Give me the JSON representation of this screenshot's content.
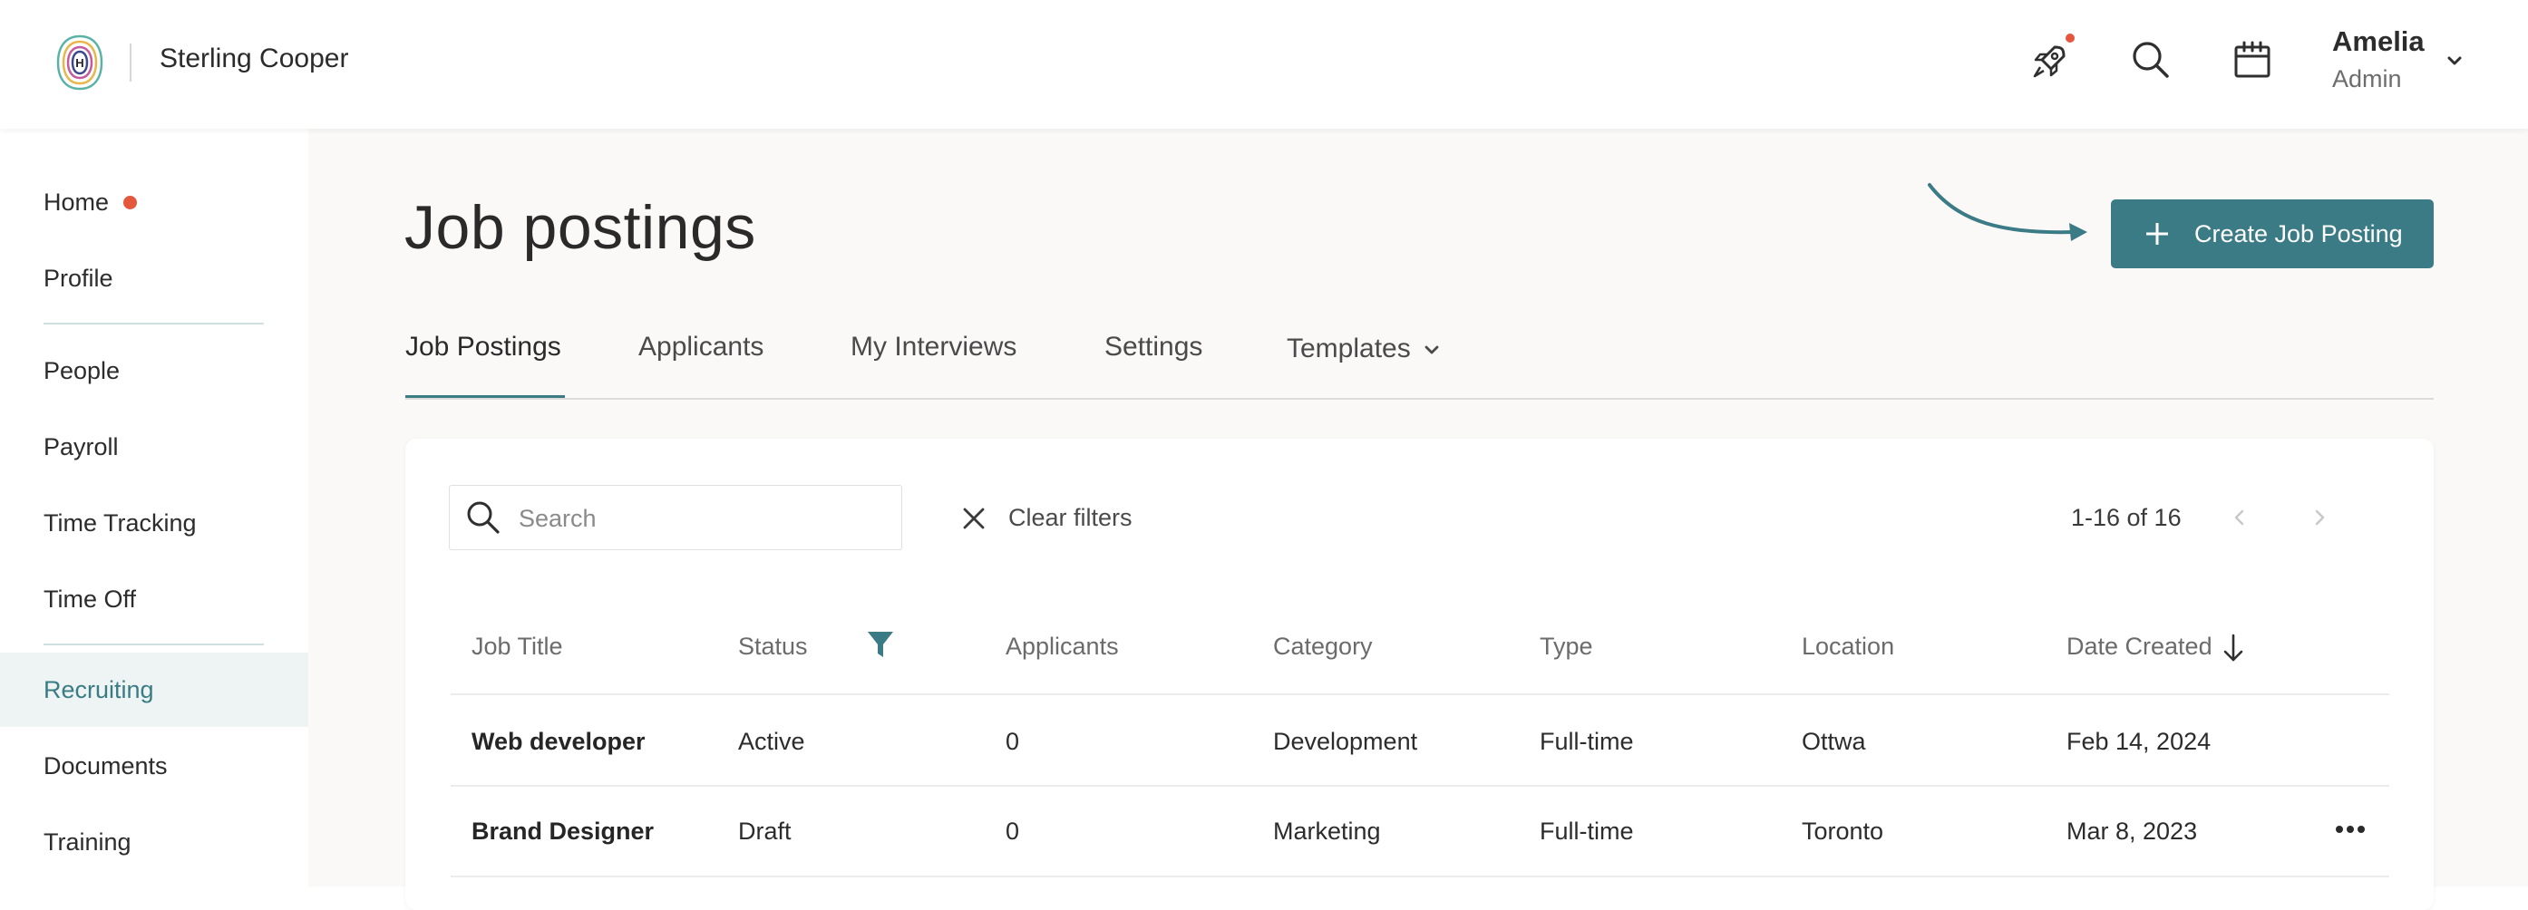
{
  "brand": {
    "name": "Sterling Cooper",
    "logo_letter": "H"
  },
  "header": {
    "icons": [
      "rocket-icon",
      "search-icon",
      "calendar-icon"
    ],
    "user": {
      "name": "Amelia",
      "role": "Admin"
    },
    "accent_notification": "#e4573d"
  },
  "sidebar": {
    "items": [
      {
        "label": "Home",
        "badge": true
      },
      {
        "label": "Profile"
      },
      {
        "label": "People"
      },
      {
        "label": "Payroll"
      },
      {
        "label": "Time Tracking"
      },
      {
        "label": "Time Off"
      },
      {
        "label": "Recruiting",
        "active": true
      },
      {
        "label": "Documents"
      },
      {
        "label": "Training"
      }
    ]
  },
  "page": {
    "title": "Job postings",
    "create_button": "Create Job Posting",
    "tabs": [
      {
        "label": "Job Postings",
        "active": true
      },
      {
        "label": "Applicants"
      },
      {
        "label": "My Interviews"
      },
      {
        "label": "Settings"
      },
      {
        "label": "Templates",
        "dropdown": true
      }
    ]
  },
  "toolbar": {
    "search_placeholder": "Search",
    "clear_filters": "Clear filters",
    "pagination": "1-16 of 16"
  },
  "table": {
    "columns": [
      "Job Title",
      "Status",
      "Applicants",
      "Category",
      "Type",
      "Location",
      "Date Created"
    ],
    "sort_column": "Date Created",
    "sort_direction": "desc",
    "rows": [
      {
        "title": "Web developer",
        "status": "Active",
        "applicants": "0",
        "category": "Development",
        "type": "Full-time",
        "location": "Ottwa",
        "date": "Feb 14, 2024"
      },
      {
        "title": "Brand Designer",
        "status": "Draft",
        "applicants": "0",
        "category": "Marketing",
        "type": "Full-time",
        "location": "Toronto",
        "date": "Mar 8, 2023"
      }
    ]
  },
  "colors": {
    "primary": "#3b7b86",
    "active_nav_bg": "#eef4f4",
    "badge": "#e4573d"
  }
}
